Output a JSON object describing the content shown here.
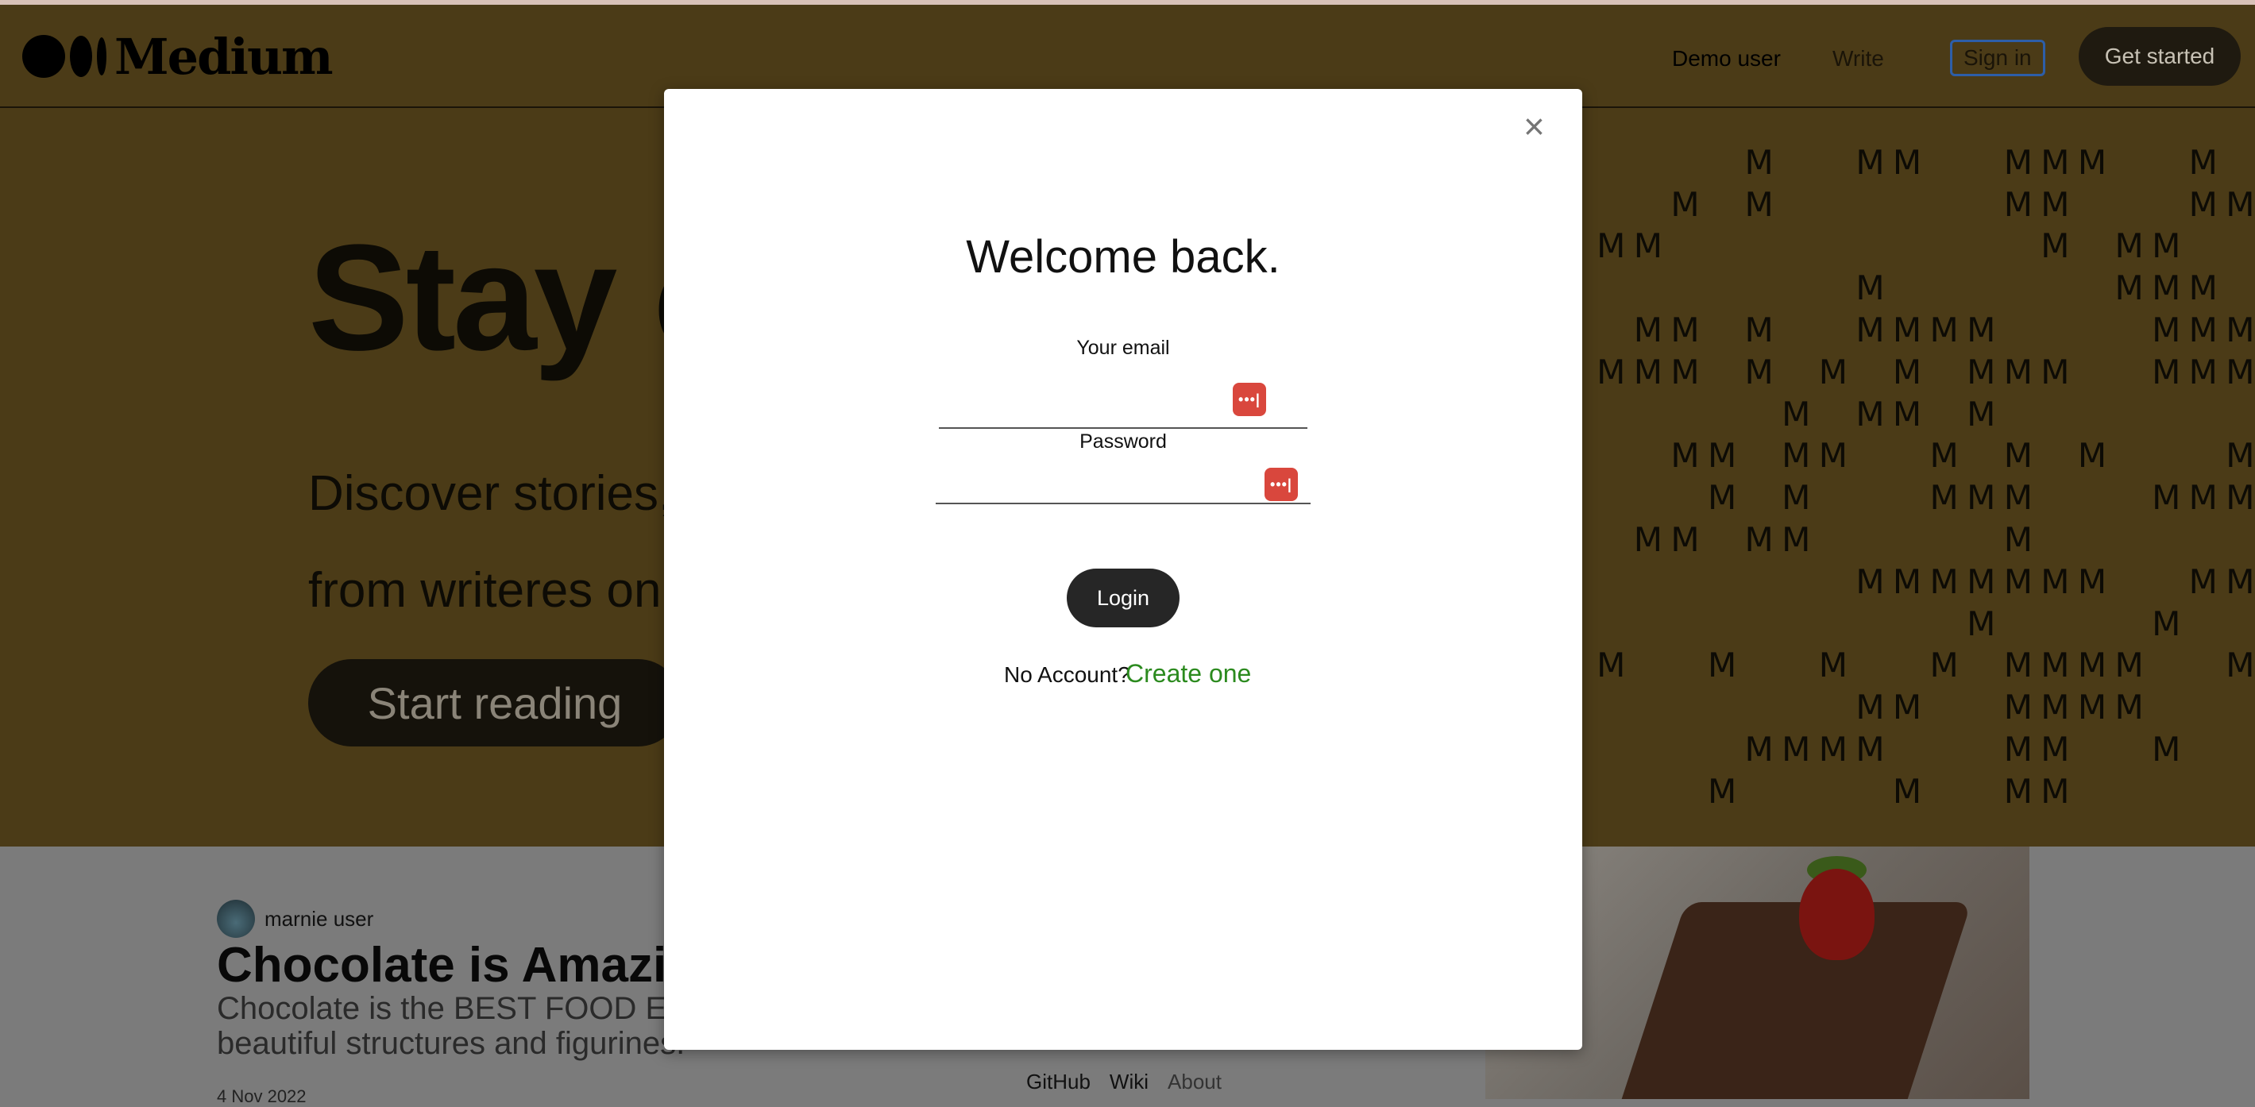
{
  "navbar": {
    "logo_text": "Medium",
    "links": {
      "demo_user": "Demo user",
      "write": "Write",
      "sign_in": "Sign in",
      "get_started": "Get started"
    }
  },
  "hero": {
    "title": "Stay cu",
    "subtitle_line1": "Discover stories, th",
    "subtitle_line2": "from writeres on ar",
    "button": "Start reading"
  },
  "m_pattern": [
    "    M  MM  MMM  M  M",
    "  M M      MM   MM  ",
    "MM          M MM   MM",
    "       M      MMM    ",
    " MM M  MMMM    MMMM  ",
    "MMM M M M MMM  MMMM  ",
    "     M MM M       M  ",
    "  MM MM  M M M   MM  ",
    "   M M   MMM   MMM   ",
    " MM MM     M         ",
    "       MMMMMMM  MMM  ",
    "          M    M   M ",
    "M  M  M  M MMMM  M  M",
    "       MM  MMMM     M",
    "    MMMM   MM  M  MM ",
    "   M    M  MM        "
  ],
  "post": {
    "author": "marnie user",
    "title": "Chocolate is Amazin",
    "description": "Chocolate is the BEST FOOD E beautiful structures and figurines.",
    "date": "4 Nov 2022"
  },
  "footer": {
    "github": "GitHub",
    "wiki": "Wiki",
    "about": "About"
  },
  "modal": {
    "close_symbol": "×",
    "title": "Welcome back.",
    "email_label": "Your email",
    "email_value": "",
    "password_label": "Password",
    "password_value": "",
    "password_manager_icon": "•••|",
    "login_button": "Login",
    "no_account_text": "No Account?",
    "create_link": "Create one"
  },
  "colors": {
    "nav_bg": "#4b3b17",
    "overlay_gray": "#7b7b7b",
    "login_button_bg": "#262626",
    "create_link": "#2b8a1e",
    "pw_manager_icon": "#d9473d"
  }
}
